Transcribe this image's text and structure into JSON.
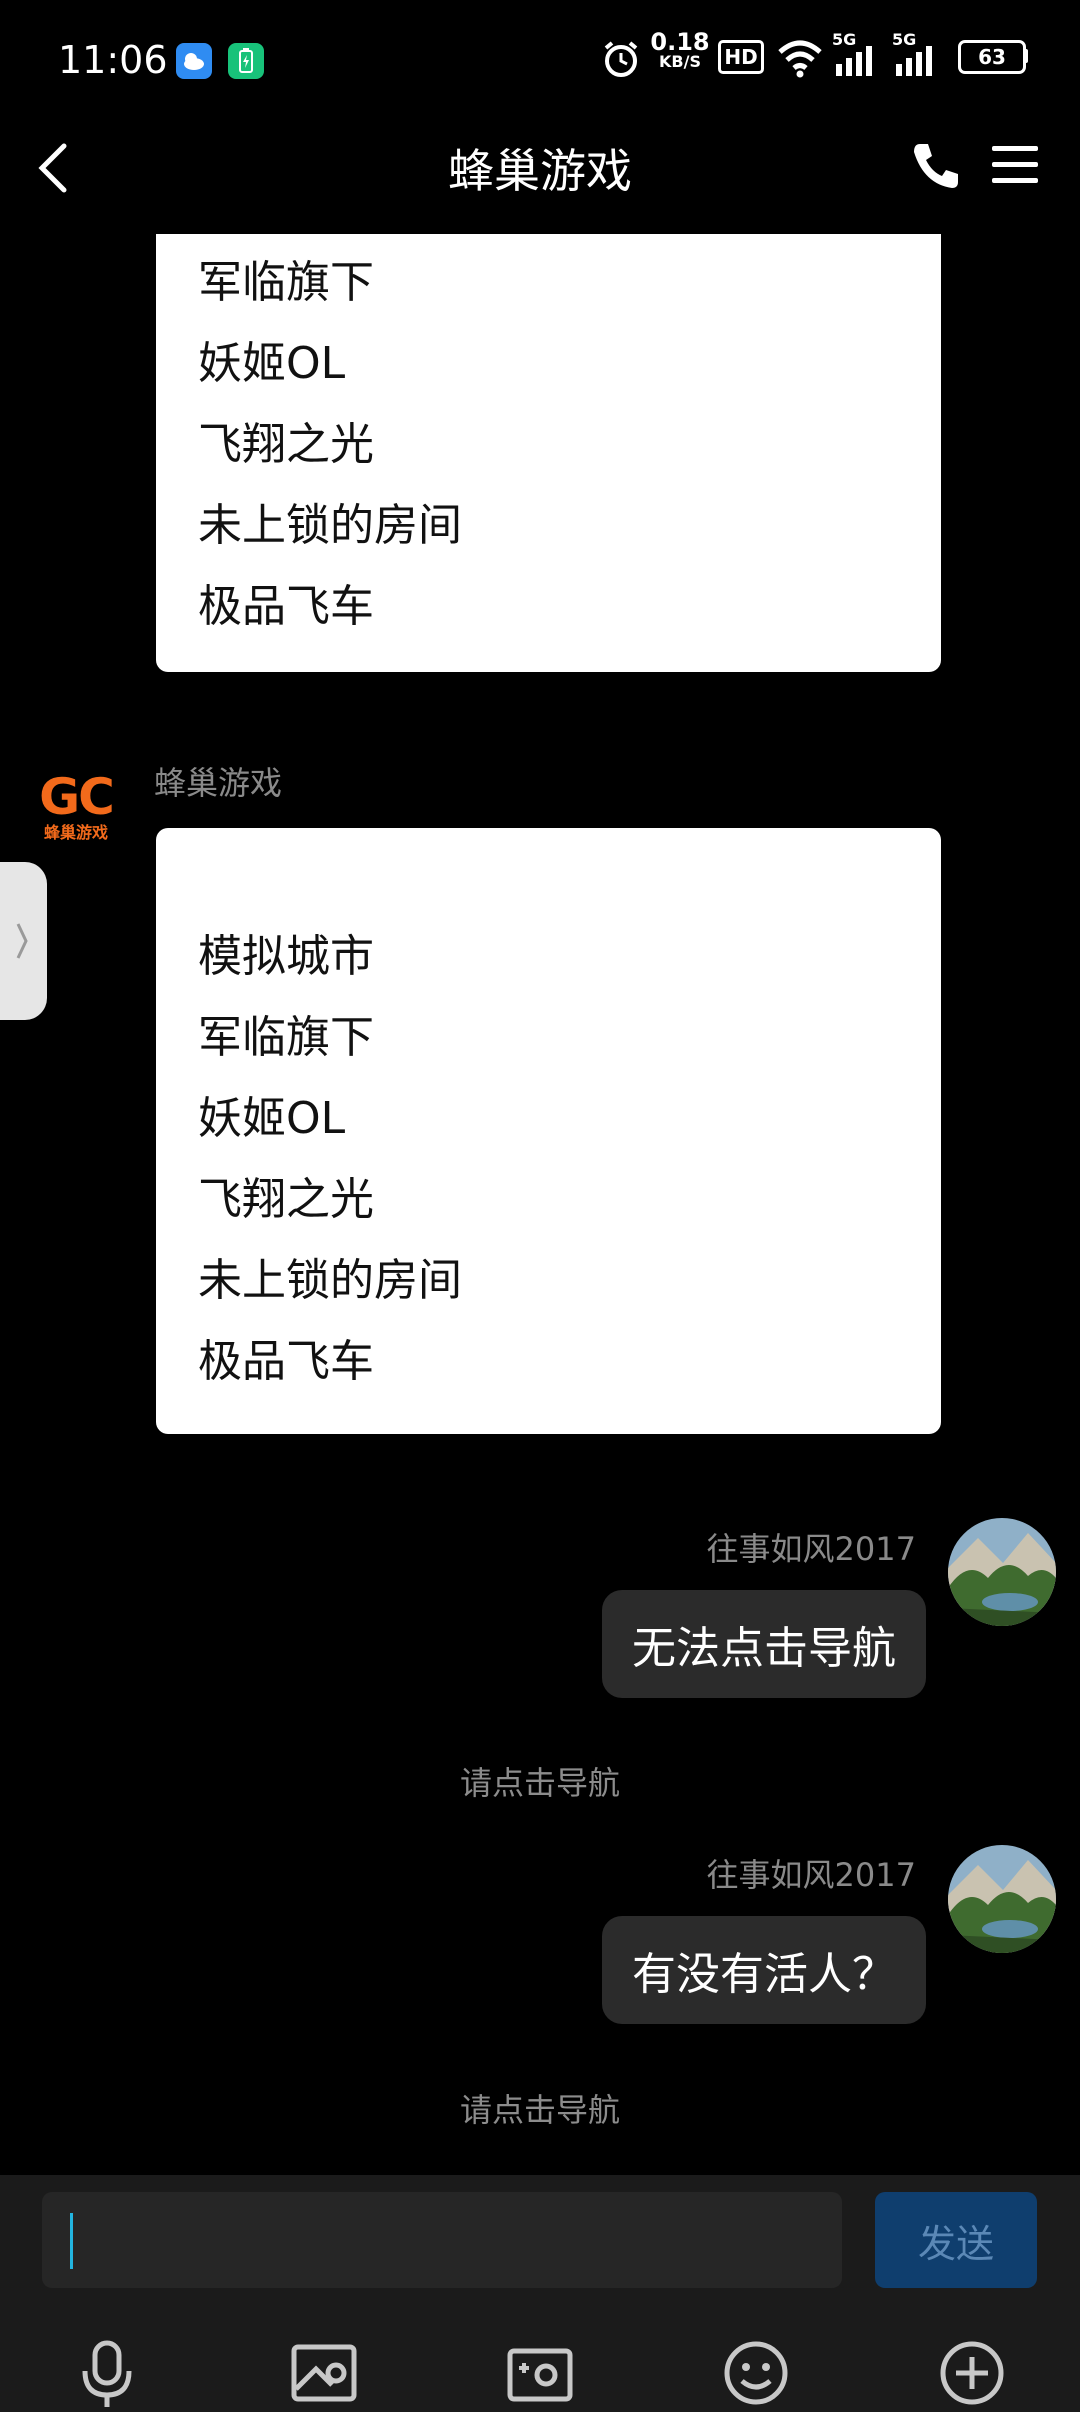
{
  "status_bar": {
    "time": "11:06",
    "net_speed_value": "0.18",
    "net_speed_unit": "KB/S",
    "hd_label": "HD",
    "signal1_label": "5G",
    "signal2_label": "5G",
    "battery": "63"
  },
  "header": {
    "title": "蜂巢游戏"
  },
  "messages": {
    "first_card_lines": [
      "军临旗下",
      "妖姬OL",
      "飞翔之光",
      "未上锁的房间",
      "极品飞车"
    ],
    "bot_name": "蜂巢游戏",
    "bot_logo_text": "GC",
    "bot_logo_sub": "蜂巢游戏",
    "second_card_lines": [
      "模拟城市",
      "军临旗下",
      "妖姬OL",
      "飞翔之光",
      "未上锁的房间",
      "极品飞车"
    ],
    "user_name_1": "往事如风2017",
    "user_msg_1": "无法点击导航",
    "system_1": "请点击导航",
    "user_name_2": "往事如风2017",
    "user_msg_2": "有没有活人？",
    "system_2": "请点击导航"
  },
  "input": {
    "value": "",
    "send_label": "发送"
  },
  "colors": {
    "accent_caret": "#23b5e0",
    "logo_orange": "#f26a1b",
    "send_bg": "#0f3e6e"
  }
}
